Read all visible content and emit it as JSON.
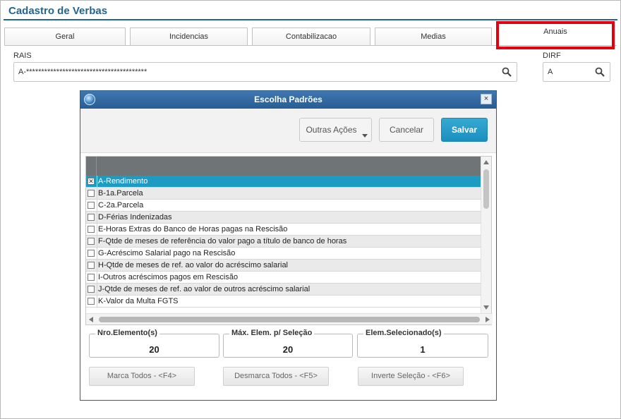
{
  "header": {
    "title": "Cadastro de Verbas"
  },
  "tabs": [
    {
      "label": "Geral"
    },
    {
      "label": "Incidencias"
    },
    {
      "label": "Contabilizacao"
    },
    {
      "label": "Medias"
    },
    {
      "label": "Anuais"
    }
  ],
  "highlight_color": "#e3000f",
  "fields": {
    "rais": {
      "label": "RAIS",
      "value": "A-****************************************"
    },
    "dirf": {
      "label": "DIRF",
      "value": "A"
    }
  },
  "dialog": {
    "title": "Escolha Padrões",
    "toolbar": {
      "other_actions": "Outras Ações",
      "cancel": "Cancelar",
      "save": "Salvar"
    },
    "rows": [
      {
        "label": "A-Rendimento",
        "checked": true,
        "selected": true
      },
      {
        "label": "B-1a.Parcela",
        "checked": false
      },
      {
        "label": "C-2a.Parcela",
        "checked": false
      },
      {
        "label": "D-Férias Indenizadas",
        "checked": false
      },
      {
        "label": "E-Horas Extras do Banco de Horas pagas na Rescisão",
        "checked": false
      },
      {
        "label": "F-Qtde de meses de referência do valor pago a título de banco de horas",
        "checked": false
      },
      {
        "label": "G-Acréscimo Salarial pago na Rescisão",
        "checked": false
      },
      {
        "label": "H-Qtde de meses de ref. ao valor do acréscimo salarial",
        "checked": false
      },
      {
        "label": "I-Outros acréscimos pagos em Rescisão",
        "checked": false
      },
      {
        "label": "J-Qtde de meses de ref. ao valor de outros acréscimo salarial",
        "checked": false
      },
      {
        "label": "K-Valor da Multa FGTS",
        "checked": false
      }
    ],
    "counters": {
      "nro_elemento": {
        "label": "Nro.Elemento(s)",
        "value": "20"
      },
      "max_elem": {
        "label": "Máx. Elem. p/ Seleção",
        "value": "20"
      },
      "selecionado": {
        "label": "Elem.Selecionado(s)",
        "value": "1"
      }
    },
    "actions": {
      "mark_all": "Marca Todos - <F4>",
      "unmark_all": "Desmarca Todos - <F5>",
      "invert": "Inverte Seleção - <F6>"
    }
  },
  "colors": {
    "title_blue": "#21668f",
    "primary_button": "#1e9bc2",
    "grid_header": "#6f7576"
  }
}
